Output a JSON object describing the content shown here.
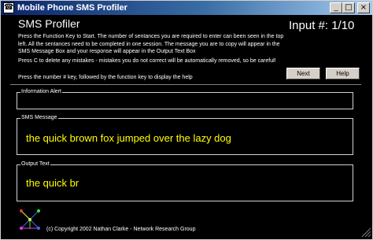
{
  "window": {
    "title": "Mobile Phone SMS Profiler",
    "icon": "phone-app-icon",
    "controls": {
      "minimize": "_",
      "maximize": "□",
      "close": "×"
    }
  },
  "header": {
    "heading": "SMS Profiler",
    "counter": "Input #:  1/10"
  },
  "instructions": {
    "p1": "Press the Function Key to Start. The number of sentances you are required to enter can been seen in the top left. All the sentances need to be completed in one session. The message you are to copy will appear in the SMS Message Box and your response will appear in the Output Text Box",
    "p2": "Press C to delete any mistakes - mistakes you do not correct will be automatically removed, so be careful!",
    "p3": "Press the number # key, followed by the function key to display the help"
  },
  "buttons": {
    "next": "Next",
    "help": "Help"
  },
  "panels": {
    "info": {
      "label": "Information Alert",
      "text": ""
    },
    "sms": {
      "label": "SMS Message",
      "text": "the quick brown fox jumped over the lazy dog"
    },
    "output": {
      "label": "Output Text",
      "text": "the quick br"
    }
  },
  "footer": {
    "copyright": "(c) Copyright 2002 Nathan Clarke - Network Research Group"
  },
  "colors": {
    "background": "#000000",
    "text": "#ffffff",
    "highlight_text": "#ffff00",
    "button_face": "#d4d0c8"
  }
}
